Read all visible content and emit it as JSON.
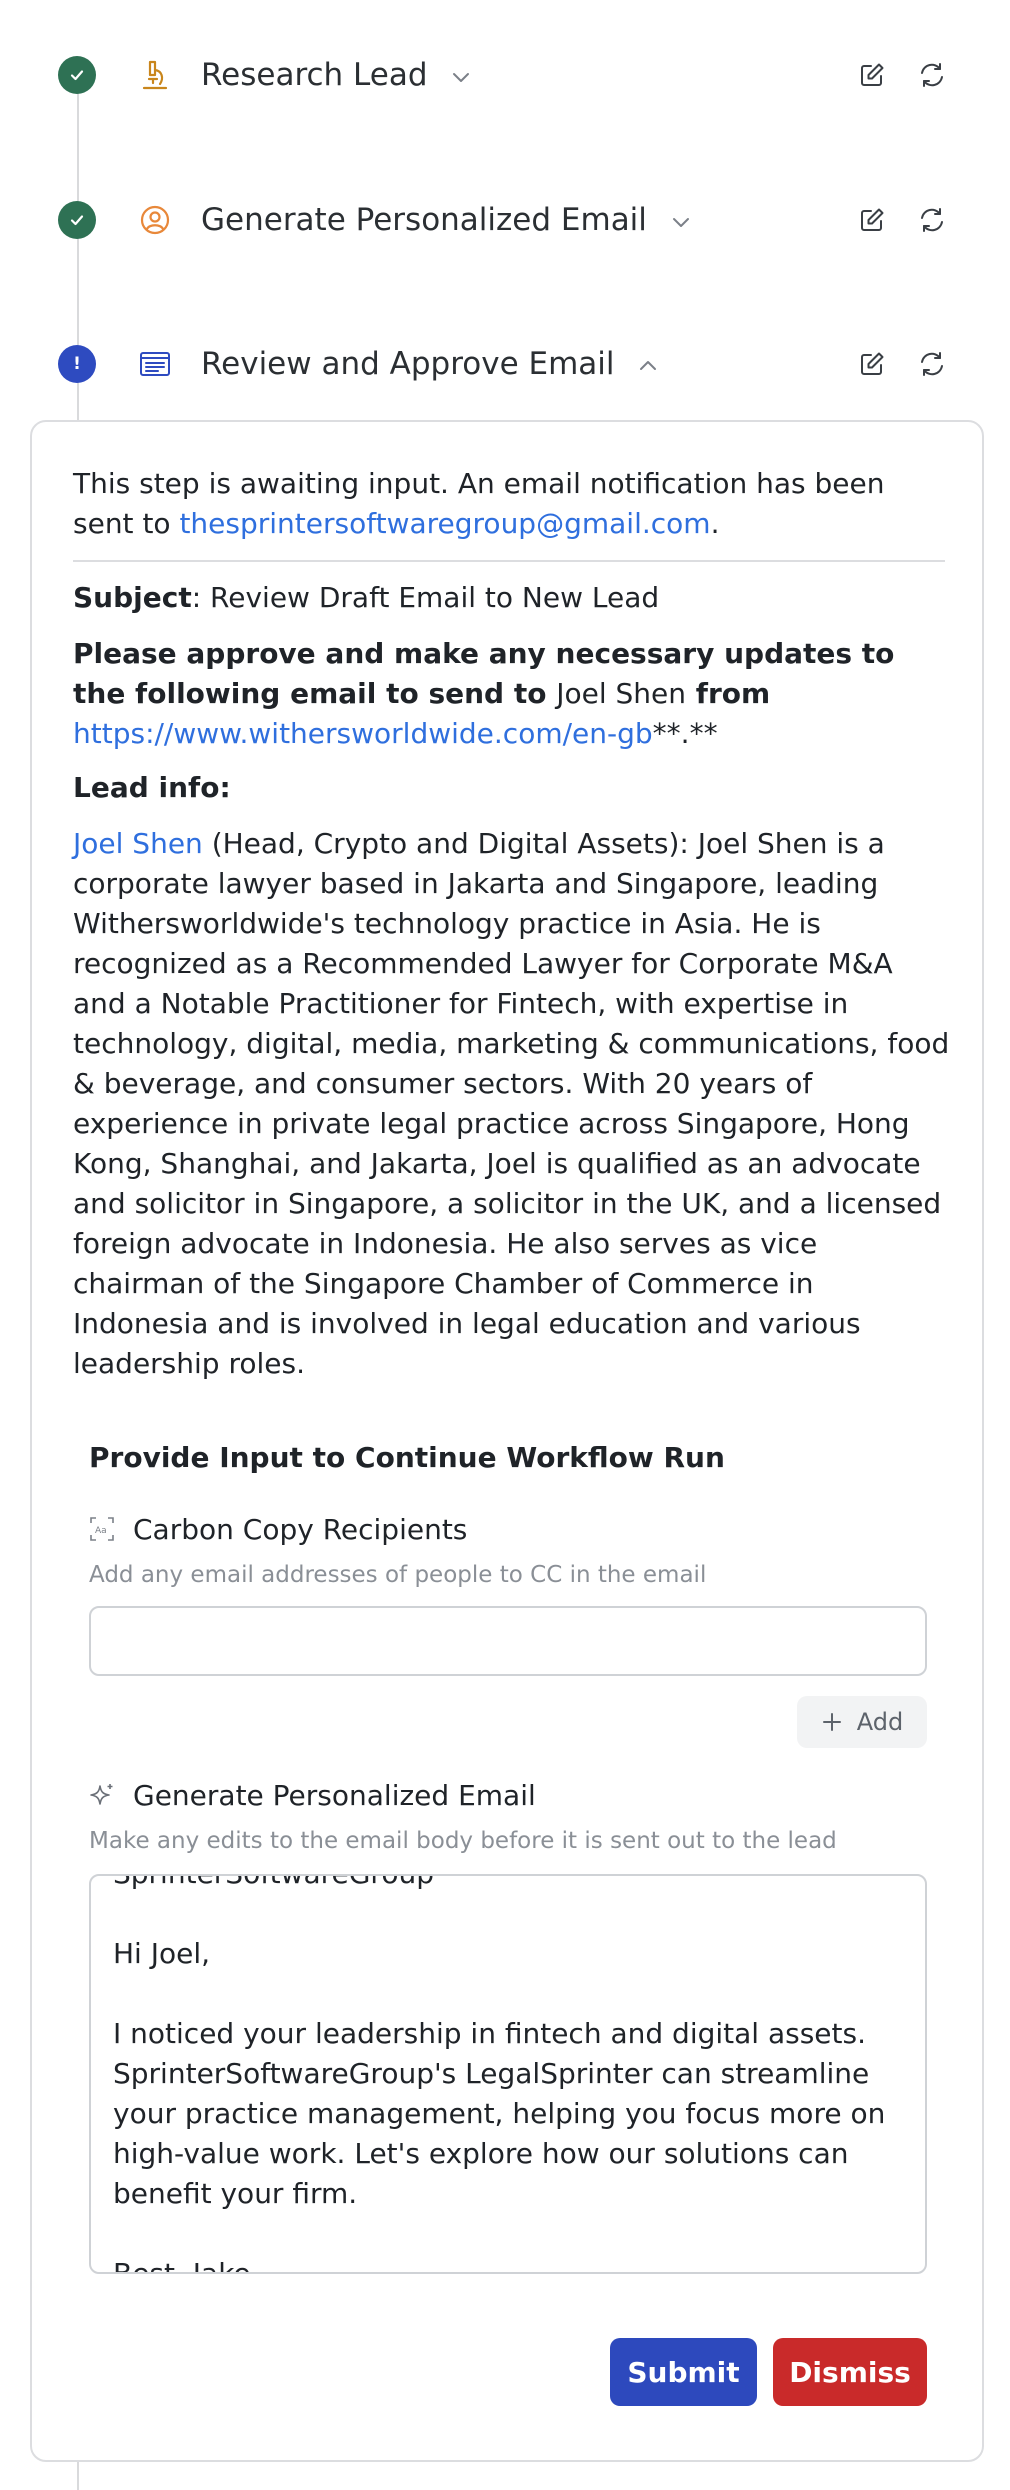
{
  "steps": [
    {
      "title": "Research Lead",
      "status": "complete",
      "icon": "microscope-icon",
      "expanded": false
    },
    {
      "title": "Generate Personalized Email",
      "status": "complete",
      "icon": "user-circle-icon",
      "expanded": false
    },
    {
      "title": "Review and Approve Email",
      "status": "awaiting-input",
      "icon": "form-icon",
      "expanded": true
    }
  ],
  "colors": {
    "complete": "#2e7154",
    "pending": "#2e4bc0",
    "link": "#2f6fde",
    "submit": "#2d49bd",
    "dismiss": "#c92a2a",
    "step_icon_orange": "#e8883a",
    "step_icon_amber": "#c9861c"
  },
  "review": {
    "notice_text": "This step is awaiting input. An email notification has been sent to ",
    "notice_email": "thesprintersoftwaregroup@gmail.com",
    "notice_end": ".",
    "subject_label": "Subject",
    "subject_value": ": Review Draft Email to New Lead",
    "approve_bold": "Please approve and make any necessary updates to the following email to send to ",
    "approve_name": "Joel Shen",
    "approve_from": " from",
    "approve_url": "https://www.withersworldwide.com/en-gb",
    "approve_suffix": "**.**",
    "lead_info_heading": "Lead info:",
    "lead_name": "Joel Shen",
    "lead_text": " (Head, Crypto and Digital Assets): Joel Shen is a corporate lawyer based in Jakarta and Singapore, leading Withersworldwide's technology practice in Asia. He is recognized as a Recommended Lawyer for Corporate M&A and a Notable Practitioner for Fintech, with expertise in technology, digital, media, marketing & communications, food & beverage, and consumer sectors. With 20 years of experience in private legal practice across Singapore, Hong Kong, Shanghai, and Jakarta, Joel is qualified as an advocate and solicitor in Singapore, a solicitor in the UK, and a licensed foreign advocate in Indonesia. He also serves as vice chairman of the Singapore Chamber of Commerce in Indonesia and is involved in legal education and various leadership roles."
  },
  "form": {
    "title": "Provide Input to Continue Workflow Run",
    "cc": {
      "label": "Carbon Copy Recipients",
      "help": "Add any email addresses of people to CC in the email",
      "value": "",
      "add_label": "Add"
    },
    "email": {
      "label": "Generate Personalized Email",
      "help": "Make any edits to the email body before it is sent out to the lead",
      "body": "SprinterSoftwareGroup\n\nHi Joel,\n\nI noticed your leadership in fintech and digital assets. SprinterSoftwareGroup's LegalSprinter can streamline your practice management, helping you focus more on high-value work. Let's explore how our solutions can benefit your firm.\n\nBest, Jake"
    },
    "submit_label": "Submit",
    "dismiss_label": "Dismiss"
  }
}
